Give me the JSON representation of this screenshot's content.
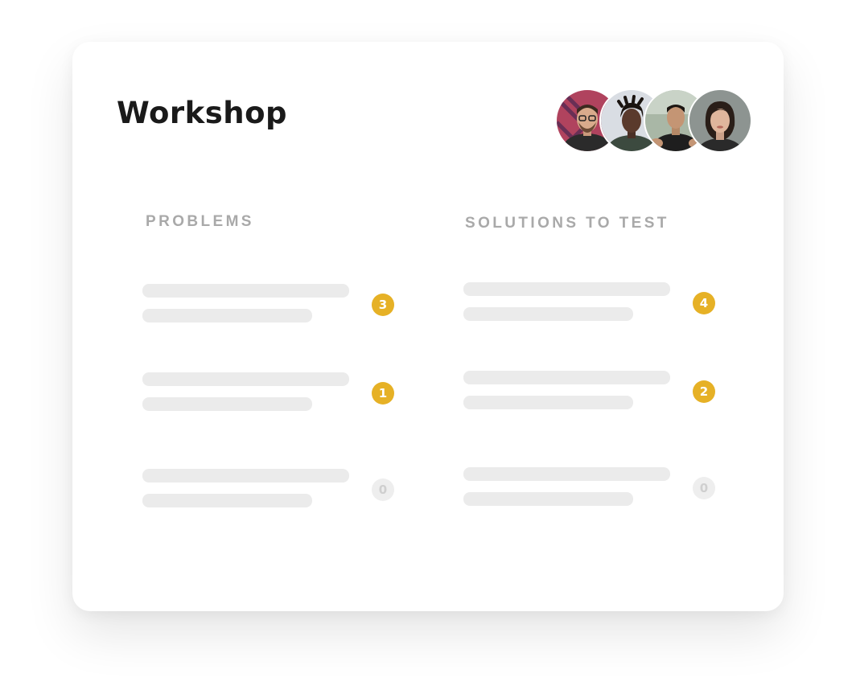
{
  "workshop": {
    "title": "Workshop"
  },
  "participants": [
    {
      "name": "participant-1"
    },
    {
      "name": "participant-2"
    },
    {
      "name": "participant-3"
    },
    {
      "name": "participant-4"
    }
  ],
  "columns": {
    "problems": {
      "title": "PROBLEMS",
      "items": [
        {
          "count": "3"
        },
        {
          "count": "1"
        },
        {
          "count": "0"
        }
      ]
    },
    "solutions": {
      "title": "SOLUTIONS TO TEST",
      "items": [
        {
          "count": "4"
        },
        {
          "count": "2"
        },
        {
          "count": "0"
        }
      ]
    }
  },
  "colors": {
    "accent": "#e6b126",
    "placeholder": "#ebebeb",
    "heading": "#1a1a1a",
    "label": "#a9a9a9"
  }
}
